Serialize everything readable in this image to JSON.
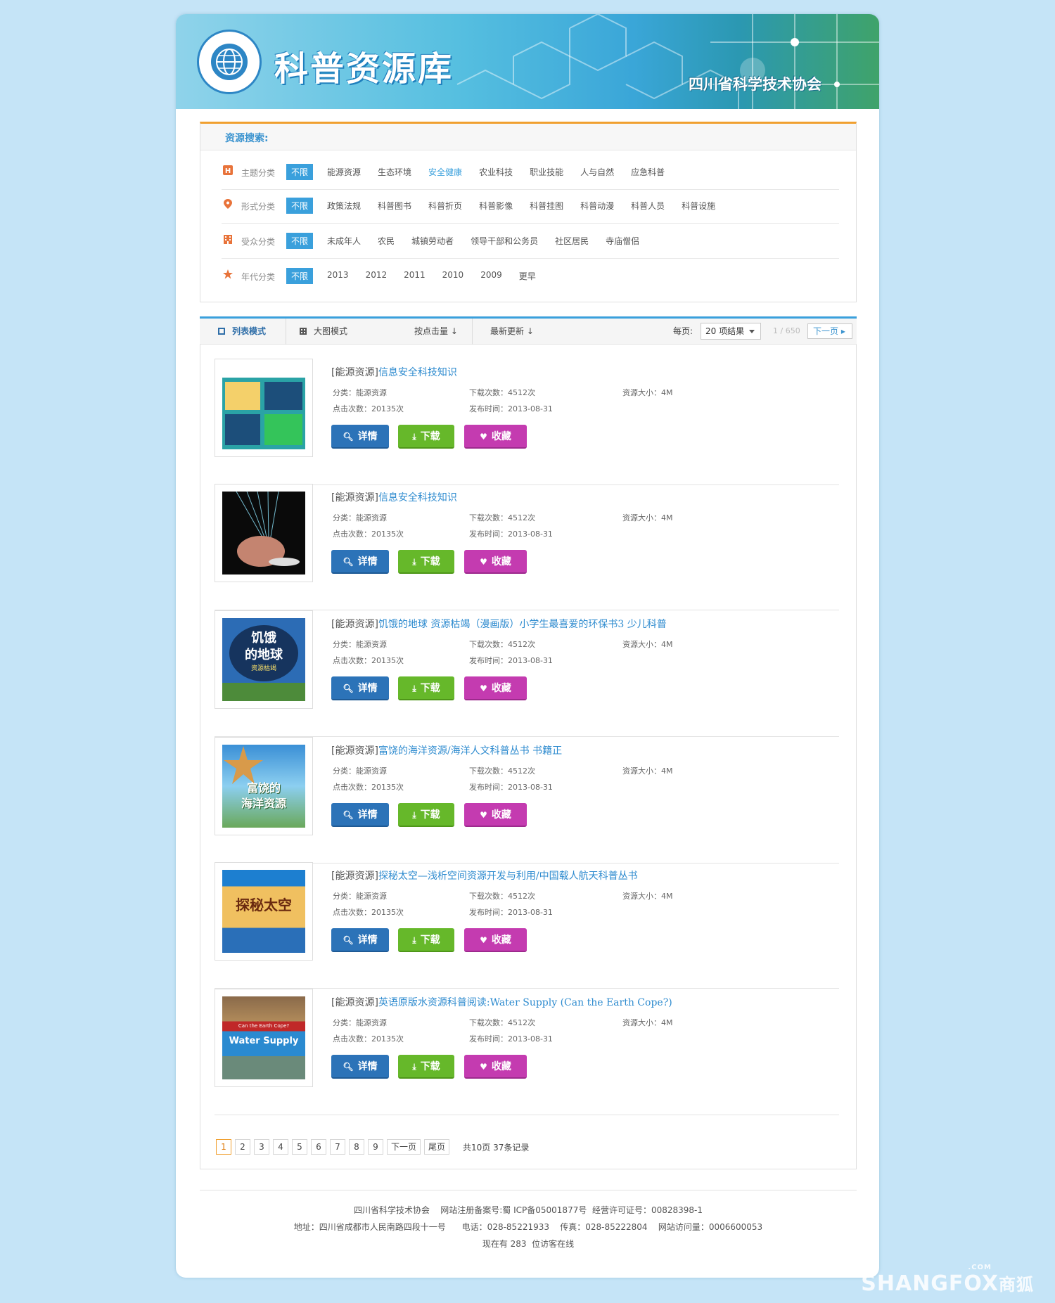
{
  "header": {
    "site_title": "科普资源库",
    "org_name": "四川省科学技术协会"
  },
  "search": {
    "heading": "资源搜索:",
    "filters": [
      {
        "label": "主题分类",
        "any": "不限",
        "options": [
          "能源资源",
          "生态环境",
          "安全健康",
          "农业科技",
          "职业技能",
          "人与自然",
          "应急科普"
        ],
        "active": "安全健康",
        "icon": "h-icon"
      },
      {
        "label": "形式分类",
        "any": "不限",
        "options": [
          "政策法规",
          "科普图书",
          "科普折页",
          "科普影像",
          "科普挂图",
          "科普动漫",
          "科普人员",
          "科普设施"
        ],
        "icon": "location-pin-icon"
      },
      {
        "label": "受众分类",
        "any": "不限",
        "options": [
          "未成年人",
          "农民",
          "城镇劳动者",
          "领导干部和公务员",
          "社区居民",
          "寺庙僧侣"
        ],
        "icon": "building-icon"
      },
      {
        "label": "年代分类",
        "any": "不限",
        "options": [
          "2013",
          "2012",
          "2011",
          "2010",
          "2009",
          "更早"
        ],
        "icon": "star-icon"
      }
    ]
  },
  "toolbar": {
    "list_mode": "列表模式",
    "grid_mode": "大图模式",
    "sort_clicks": "按点击量",
    "sort_latest": "最新更新",
    "per_page_label": "每页:",
    "per_page_value": "20 项结果",
    "page_info": "1 / 650",
    "next_label": "下一页"
  },
  "colors": {
    "accent_blue": "#3aa0dc",
    "accent_orange": "#f0a030",
    "detail_button": "#2c73b8",
    "download_button": "#66b82a",
    "favorite_button": "#c43bb0"
  },
  "items": [
    {
      "category": "[能源资源]",
      "title": "信息安全科技知识",
      "class_text": "分类：能源资源",
      "downloads": "下载次数：4512次",
      "size": "资源大小：4M",
      "clicks": "点击次数：20135次",
      "date": "发布时间：2013-08-31"
    },
    {
      "category": "[能源资源]",
      "title": "信息安全科技知识",
      "class_text": "分类：能源资源",
      "downloads": "下载次数：4512次",
      "size": "资源大小：4M",
      "clicks": "点击次数：20135次",
      "date": "发布时间：2013-08-31"
    },
    {
      "category": "[能源资源]",
      "title": "饥饿的地球 资源枯竭（漫画版）小学生最喜爱的环保书3 少儿科普",
      "class_text": "分类：能源资源",
      "downloads": "下载次数：4512次",
      "size": "资源大小：4M",
      "clicks": "点击次数：20135次",
      "date": "发布时间：2013-08-31",
      "cover_text": [
        "饥饿",
        "的地球",
        "资源枯竭"
      ]
    },
    {
      "category": "[能源资源]",
      "title": "富饶的海洋资源/海洋人文科普丛书 书籍正",
      "class_text": "分类：能源资源",
      "downloads": "下载次数：4512次",
      "size": "资源大小：4M",
      "clicks": "点击次数：20135次",
      "date": "发布时间：2013-08-31",
      "cover_text": [
        "富饶的",
        "海洋资源"
      ]
    },
    {
      "category": "[能源资源]",
      "title": "探秘太空—浅析空间资源开发与利用/中国载人航天科普丛书",
      "class_text": "分类：能源资源",
      "downloads": "下载次数：4512次",
      "size": "资源大小：4M",
      "clicks": "点击次数：20135次",
      "date": "发布时间：2013-08-31",
      "cover_text": [
        "探秘太空"
      ]
    },
    {
      "category": "[能源资源]",
      "title": "英语原版水资源科普阅读:Water Supply (Can the Earth Cope?)",
      "class_text": "分类：能源资源",
      "downloads": "下载次数：4512次",
      "size": "资源大小：4M",
      "clicks": "点击次数：20135次",
      "date": "发布时间：2013-08-31",
      "cover_text": [
        "Can the Earth Cope?",
        "Water Supply"
      ]
    }
  ],
  "buttons": {
    "detail": "详情",
    "download": "下载",
    "favorite": "收藏"
  },
  "pagination": {
    "pages": [
      "1",
      "2",
      "3",
      "4",
      "5",
      "6",
      "7",
      "8",
      "9"
    ],
    "current": "1",
    "next": "下一页",
    "last": "尾页",
    "total": "共10页 37条记录"
  },
  "footer": {
    "line1": "四川省科学技术协会    网站注册备案号:蜀 ICP备05001877号  经营许可证号：00828398-1",
    "line2": "地址：四川省成都市人民南路四段十一号      电话：028-85221933    传真：028-85222804    网站访问量：0006600053",
    "line3": "现在有 283  位访客在线"
  },
  "watermark": {
    "text": "SHANGFOX",
    "cn": "商狐",
    "com": ".COM"
  }
}
